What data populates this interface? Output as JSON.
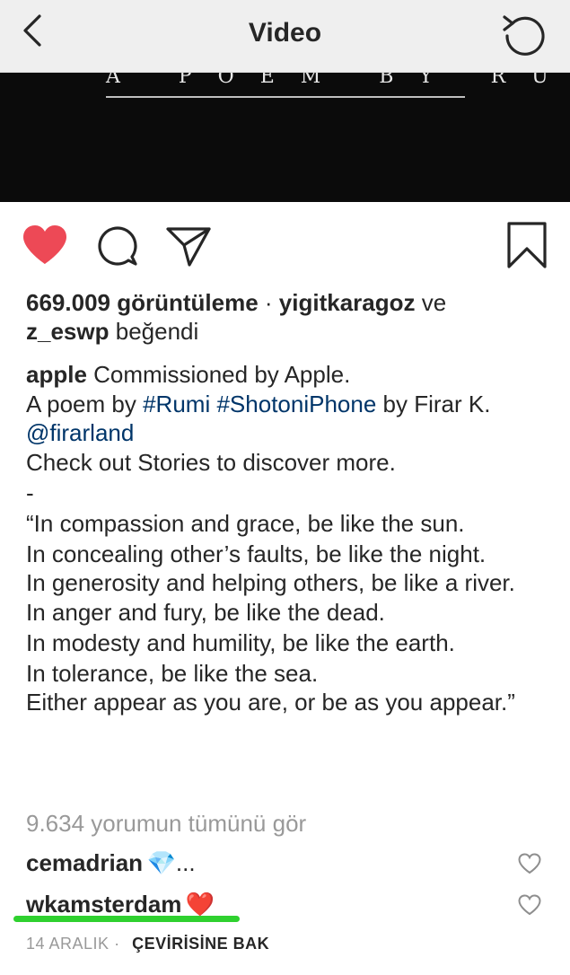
{
  "nav": {
    "title": "Video",
    "back_icon": "chevron-left-icon",
    "refresh_icon": "refresh-icon"
  },
  "video": {
    "overlay_text": "A POEM BY RUMI",
    "background": "#0b0b0b"
  },
  "actions": {
    "like_icon": "heart-filled-icon",
    "like_color": "#ed4956",
    "comment_icon": "comment-icon",
    "share_icon": "send-icon",
    "save_icon": "bookmark-icon"
  },
  "stats": {
    "views": "669.009 görüntüleme",
    "separator": "·",
    "liker1": "yigitkaragoz",
    "and": "ve",
    "liker2": "z_eswp",
    "liked": "beğendi"
  },
  "caption": {
    "username": "apple",
    "line1": "Commissioned by Apple.",
    "line2_prefix": "A poem by",
    "hashtag1": "#Rumi",
    "hashtag2": "#ShotoniPhone",
    "line2_suffix": "by Firar K.",
    "mention": "@firarland",
    "line3": "Check out Stories to discover more.",
    "line4": "-",
    "poem": [
      "“In compassion and grace, be like the sun.",
      "In concealing other’s faults, be like the night.",
      "In generosity and helping others, be like a river.",
      "In anger and fury, be like the dead.",
      "In modesty and humility, be like the earth.",
      "In tolerance, be like the sea.",
      "Either appear as you are, or be as you appear.”"
    ],
    "link_color": "#003569"
  },
  "view_all_comments": "9.634 yorumun tümünü gör",
  "comments": [
    {
      "user": "cemadrian",
      "text": "💎...",
      "like_icon": "heart-outline-icon"
    },
    {
      "user": "wkamsterdam",
      "text": "❤️",
      "like_icon": "heart-outline-icon"
    }
  ],
  "highlight_color": "#2fd12f",
  "footer": {
    "date": "14 ARALIK",
    "separator": "·",
    "translate": "ÇEVİRİSİNE BAK"
  }
}
